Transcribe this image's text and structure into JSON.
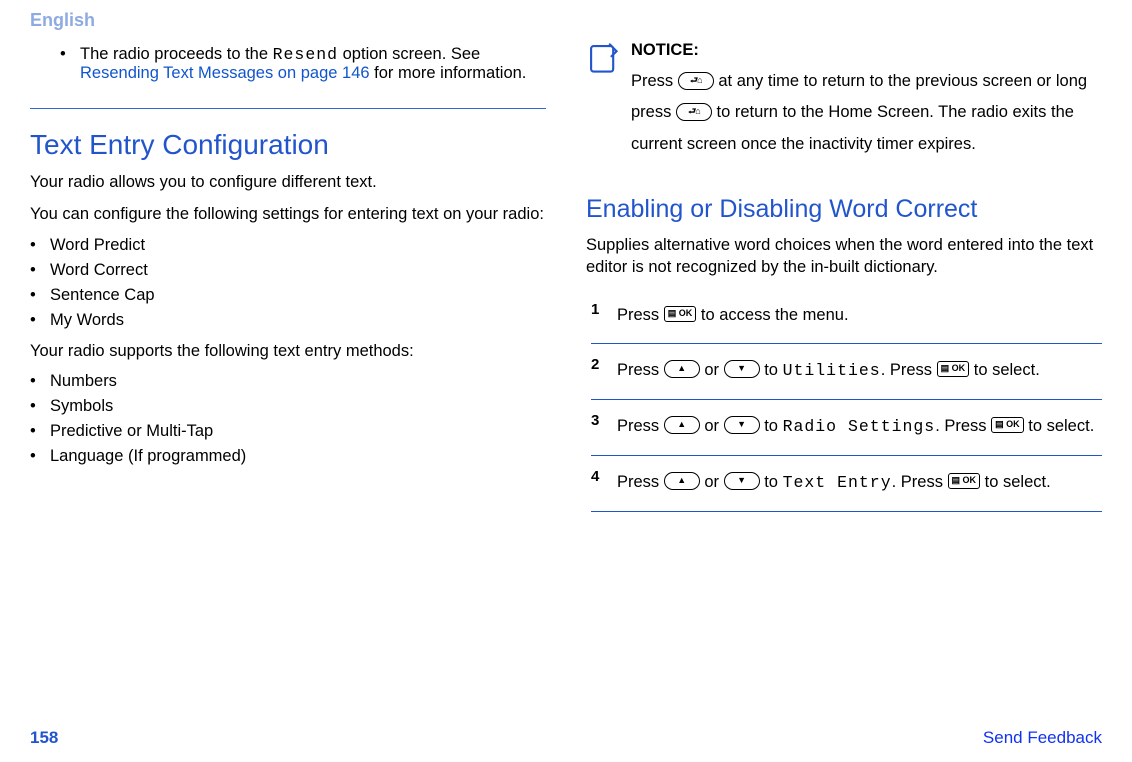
{
  "header": {
    "language": "English"
  },
  "left": {
    "bullet1_pre": "The radio proceeds to the ",
    "bullet1_mono": "Resend",
    "bullet1_mid": " option screen. See ",
    "bullet1_link": "Resending Text Messages on page 146",
    "bullet1_post": " for more information.",
    "h": "Text Entry Configuration",
    "p1": "Your radio allows you to configure different text.",
    "p2": "You can configure the following settings for entering text on your radio:",
    "list1": [
      "Word Predict",
      "Word Correct",
      "Sentence Cap",
      "My Words"
    ],
    "p3": "Your radio supports the following text entry methods:",
    "list2": [
      "Numbers",
      "Symbols",
      "Predictive or Multi-Tap",
      "Language (If programmed)"
    ]
  },
  "right": {
    "notice_label": "NOTICE:",
    "notice_p1a": "Press ",
    "notice_p1b": " at any time to return to the previous screen or long press ",
    "notice_p1c": " to return to the Home Screen. The radio exits the current screen once the inactivity timer expires.",
    "h": "Enabling or Disabling Word Correct",
    "intro": "Supplies alternative word choices when the word entered into the text editor is not recognized by the in-built dictionary.",
    "steps": {
      "s1": {
        "n": "1",
        "a": "Press ",
        "b": " to access the menu."
      },
      "s2": {
        "n": "2",
        "a": "Press ",
        "b": " or ",
        "c": " to ",
        "mono": "Utilities",
        "d": ". Press ",
        "e": " to select."
      },
      "s3": {
        "n": "3",
        "a": "Press ",
        "b": " or ",
        "c": " to ",
        "mono": "Radio Settings",
        "d": ". Press ",
        "e": " to select."
      },
      "s4": {
        "n": "4",
        "a": "Press ",
        "b": " or ",
        "c": " to ",
        "mono": "Text Entry",
        "d": ". Press ",
        "e": " to select."
      }
    }
  },
  "footer": {
    "page": "158",
    "feedback": "Send Feedback"
  },
  "icons": {
    "ok": "▤ OK"
  }
}
